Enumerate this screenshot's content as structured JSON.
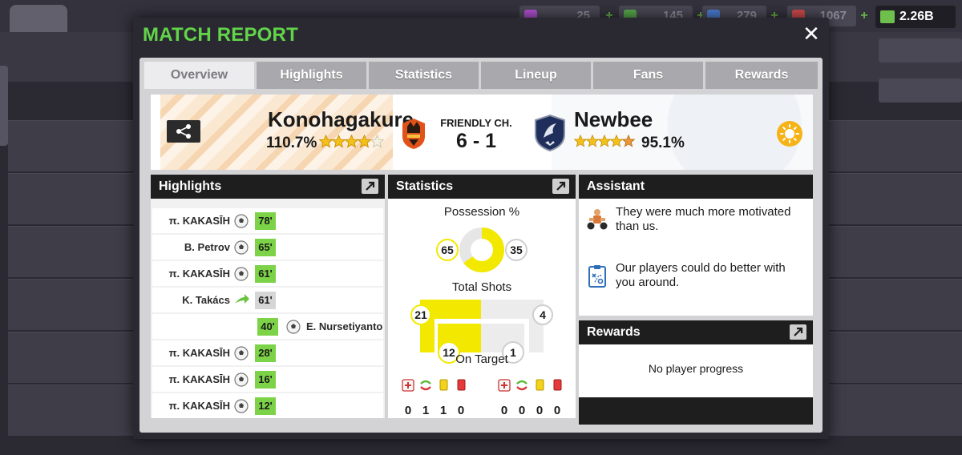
{
  "background": {
    "resources": [
      "25",
      "145",
      "279",
      "1067"
    ],
    "cash": "2.26B"
  },
  "modal": {
    "title": "MATCH REPORT",
    "close_label": "✕"
  },
  "tabs": [
    "Overview",
    "Highlights",
    "Statistics",
    "Lineup",
    "Fans",
    "Rewards"
  ],
  "active_tab": "Overview",
  "match": {
    "home_team": "Konohagakure",
    "home_rating": "110.7%",
    "home_stars": 4.5,
    "competition": "FRIENDLY CH.",
    "score": "6 - 1",
    "away_team": "Newbee",
    "away_rating": "95.1%",
    "away_stars": 4.5
  },
  "highlights": {
    "title": "Highlights",
    "events": [
      {
        "player": "π. KAKASĪH",
        "minute": "78'",
        "type": "goal",
        "side": "home"
      },
      {
        "player": "B. Petrov",
        "minute": "65'",
        "type": "goal",
        "side": "home"
      },
      {
        "player": "π. KAKASĪH",
        "minute": "61'",
        "type": "goal",
        "side": "home"
      },
      {
        "player": "K. Takács",
        "minute": "61'",
        "type": "substitution",
        "side": "home"
      },
      {
        "player": "E. Nursetiyanto",
        "minute": "40'",
        "type": "goal",
        "side": "away"
      },
      {
        "player": "π. KAKASĪH",
        "minute": "28'",
        "type": "goal",
        "side": "home"
      },
      {
        "player": "π. KAKASĪH",
        "minute": "16'",
        "type": "goal",
        "side": "home"
      },
      {
        "player": "π. KAKASĪH",
        "minute": "12'",
        "type": "goal",
        "side": "home"
      }
    ]
  },
  "statistics": {
    "title": "Statistics",
    "possession_label": "Possession %",
    "possession_home": "65",
    "possession_away": "35",
    "shots_label": "Total Shots",
    "shots_home": "21",
    "shots_away": "4",
    "on_target_label": "On Target",
    "on_target_home": "12",
    "on_target_away": "1",
    "cards_home": [
      "0",
      "1",
      "1",
      "0"
    ],
    "cards_away": [
      "0",
      "0",
      "0",
      "0"
    ]
  },
  "assistant": {
    "title": "Assistant",
    "messages": [
      "They were much more motivated than us.",
      "Our players could do better with you around."
    ]
  },
  "rewards": {
    "title": "Rewards",
    "text": "No player progress"
  },
  "colors": {
    "title_green": "#62d44a",
    "minute_green": "#7cd347",
    "stat_yellow": "#f3e900",
    "header_black": "#1e1e1e"
  }
}
